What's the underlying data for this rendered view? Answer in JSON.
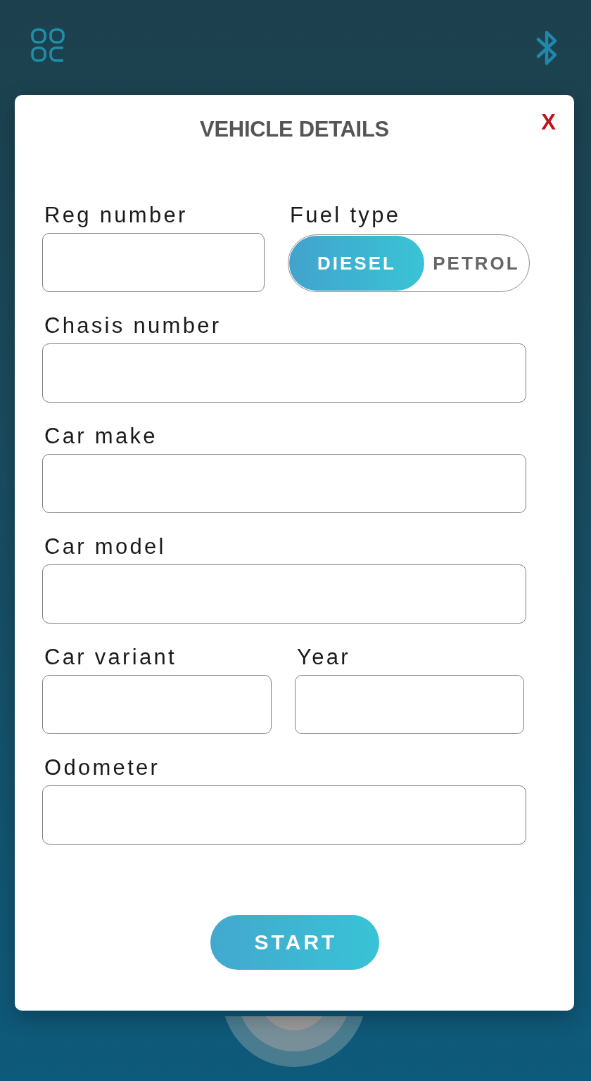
{
  "modal": {
    "title": "VEHICLE DETAILS",
    "close": "X",
    "rows": [
      {
        "fields": [
          {
            "kind": "text",
            "label": "Reg number"
          },
          {
            "kind": "toggle",
            "label": "Fuel type",
            "options": [
              {
                "label": "DIESEL",
                "selected": true
              },
              {
                "label": "PETROL",
                "selected": false
              }
            ]
          }
        ]
      },
      {
        "fields": [
          {
            "kind": "text",
            "label": "Chasis number"
          }
        ]
      },
      {
        "fields": [
          {
            "kind": "text",
            "label": "Car make"
          }
        ]
      },
      {
        "fields": [
          {
            "kind": "text",
            "label": "Car model"
          }
        ]
      },
      {
        "fields": [
          {
            "kind": "text",
            "label": "Car variant"
          },
          {
            "kind": "text",
            "label": "Year"
          }
        ]
      },
      {
        "fields": [
          {
            "kind": "text",
            "label": "Odometer"
          }
        ]
      }
    ],
    "submit": "START"
  }
}
